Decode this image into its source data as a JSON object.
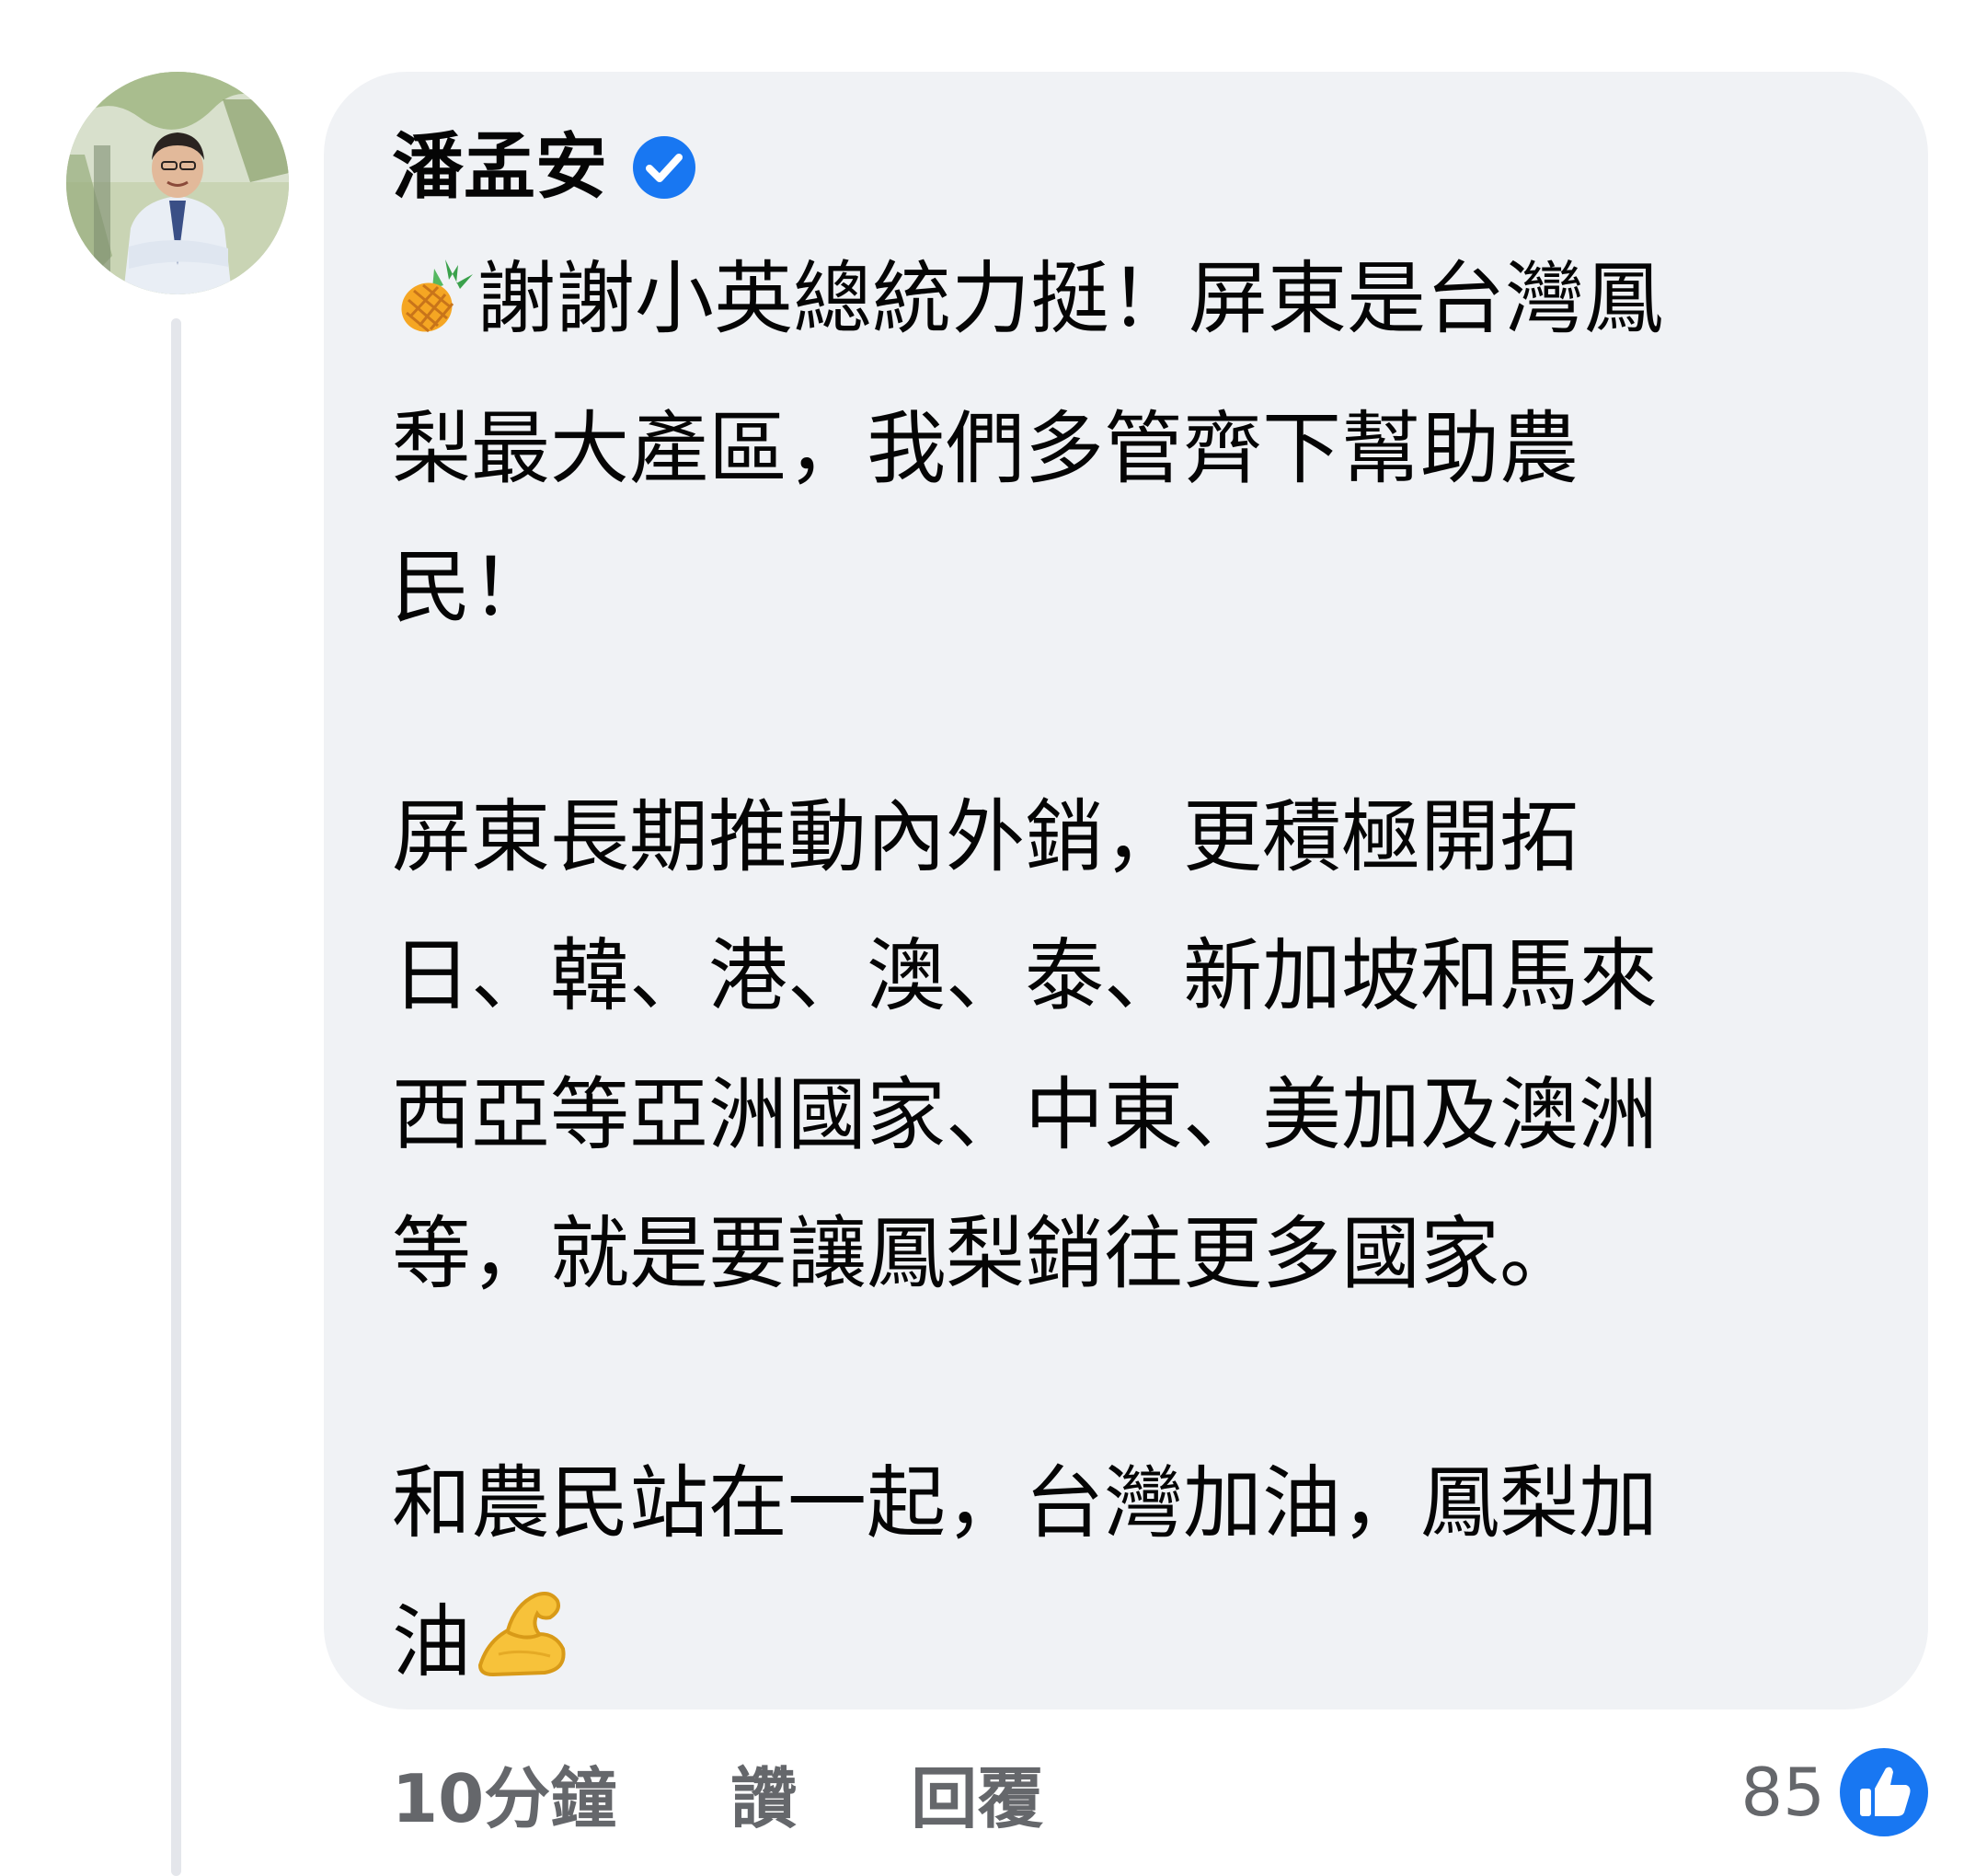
{
  "comment": {
    "author_name": "潘孟安",
    "verified_icon": "verified-badge-icon",
    "lines": [
      "謝謝小英總統力挺！屏東是台灣鳳",
      "梨最大產區，我們多管齊下幫助農",
      "民！",
      "屏東長期推動內外銷，更積極開拓",
      "日、韓、港、澳、泰、新加坡和馬來",
      "西亞等亞洲國家、中東、美加及澳洲",
      "等，就是要讓鳳梨銷往更多國家。",
      "和農民站在一起，台灣加油，鳳梨加",
      "油"
    ],
    "emoji": {
      "lead": "pineapple-emoji",
      "trail": "flexed-biceps-emoji"
    }
  },
  "actions": {
    "timestamp": "10分鐘",
    "like_label": "讚",
    "reply_label": "回覆"
  },
  "reactions": {
    "count": "85",
    "icon": "like-thumbs-up-icon"
  },
  "colors": {
    "bubble_bg": "#f0f2f5",
    "text_primary": "#050505",
    "text_secondary": "#65676b",
    "accent_blue": "#1877f2",
    "thread_line": "#e4e6eb"
  }
}
